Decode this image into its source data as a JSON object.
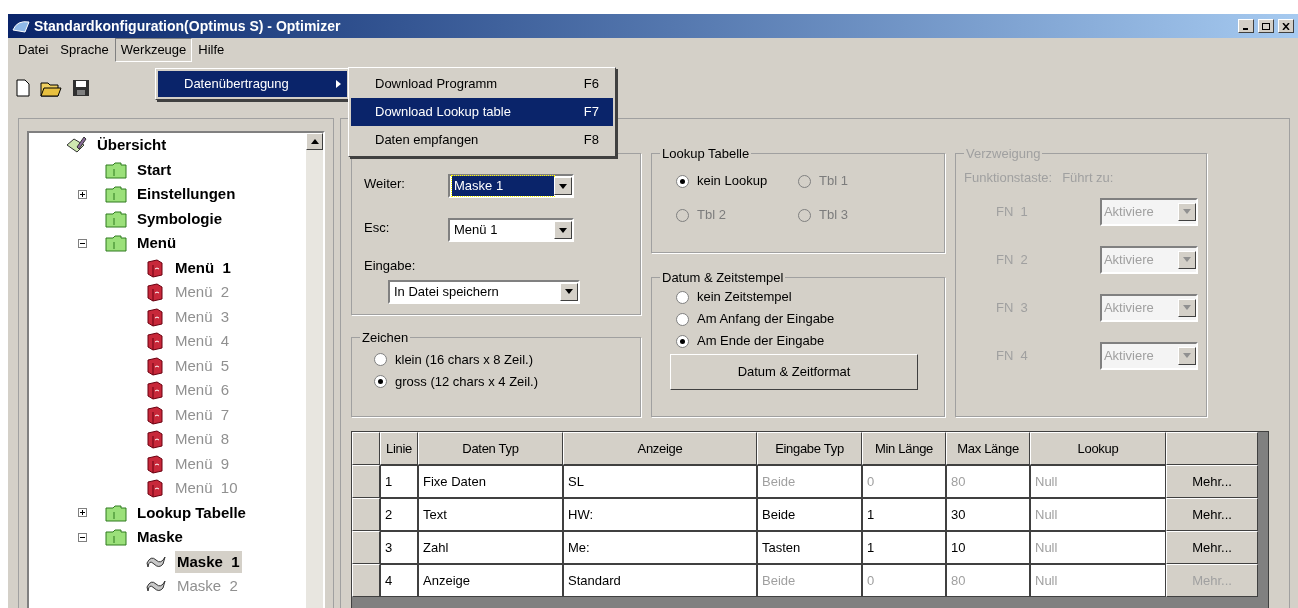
{
  "window": {
    "title": "Standardkonfiguration(Optimus S) - Optimizer"
  },
  "menu_bar": [
    {
      "label": "Datei",
      "selected": false
    },
    {
      "label": "Sprache",
      "selected": false
    },
    {
      "label": "Werkzeuge",
      "selected": true
    },
    {
      "label": "Hilfe",
      "selected": false
    }
  ],
  "menu_open": {
    "items": [
      {
        "label": "Datenübertragung",
        "selected": true
      }
    ],
    "submenu": [
      {
        "label": "Download Programm",
        "shortcut": "F6",
        "selected": false
      },
      {
        "label": "Download Lookup table",
        "shortcut": "F7",
        "selected": true
      },
      {
        "label": "Daten empfangen",
        "shortcut": "F8",
        "selected": false
      }
    ]
  },
  "tree": [
    {
      "label": "Übersicht",
      "kind": "root",
      "bold": true,
      "dim": false,
      "selected": false,
      "children": [
        {
          "label": "Start",
          "kind": "folder",
          "bold": true,
          "dim": false,
          "selected": false
        },
        {
          "label": "Einstellungen",
          "kind": "folder",
          "bold": true,
          "dim": false,
          "selected": false,
          "expanded": false
        },
        {
          "label": "Symbologie",
          "kind": "folder",
          "bold": true,
          "dim": false,
          "selected": false
        },
        {
          "label": "Menü",
          "kind": "folder",
          "bold": true,
          "dim": false,
          "selected": false,
          "expanded": true,
          "children": [
            {
              "label": "Menü  1",
              "kind": "book",
              "bold": true,
              "dim": false,
              "selected": false
            },
            {
              "label": "Menü  2",
              "kind": "book",
              "bold": false,
              "dim": true,
              "selected": false
            },
            {
              "label": "Menü  3",
              "kind": "book",
              "bold": false,
              "dim": true,
              "selected": false
            },
            {
              "label": "Menü  4",
              "kind": "book",
              "bold": false,
              "dim": true,
              "selected": false
            },
            {
              "label": "Menü  5",
              "kind": "book",
              "bold": false,
              "dim": true,
              "selected": false
            },
            {
              "label": "Menü  6",
              "kind": "book",
              "bold": false,
              "dim": true,
              "selected": false
            },
            {
              "label": "Menü  7",
              "kind": "book",
              "bold": false,
              "dim": true,
              "selected": false
            },
            {
              "label": "Menü  8",
              "kind": "book",
              "bold": false,
              "dim": true,
              "selected": false
            },
            {
              "label": "Menü  9",
              "kind": "book",
              "bold": false,
              "dim": true,
              "selected": false
            },
            {
              "label": "Menü  10",
              "kind": "book",
              "bold": false,
              "dim": true,
              "selected": false
            }
          ]
        },
        {
          "label": "Lookup Tabelle",
          "kind": "folder",
          "bold": true,
          "dim": false,
          "selected": false,
          "expanded": false
        },
        {
          "label": "Maske",
          "kind": "folder",
          "bold": true,
          "dim": false,
          "selected": false,
          "expanded": true,
          "children": [
            {
              "label": "Maske  1",
              "kind": "mask",
              "bold": true,
              "dim": false,
              "selected": true
            },
            {
              "label": "Maske  2",
              "kind": "mask",
              "bold": false,
              "dim": true,
              "selected": false
            }
          ]
        }
      ]
    }
  ],
  "ereignis": {
    "fields": [
      {
        "label": "Weiter:",
        "value": "Maske 1",
        "focused": true
      },
      {
        "label": "Esc:",
        "value": "Menü 1",
        "focused": false
      }
    ],
    "eingabe_label": "Eingabe:",
    "eingabe_value": "In Datei speichern"
  },
  "zeichen": {
    "title": "Zeichen",
    "options": [
      {
        "label": "klein (16 chars x 8 Zeil.)",
        "selected": false,
        "disabled": false
      },
      {
        "label": "gross (12 chars x 4 Zeil.)",
        "selected": true,
        "disabled": false
      }
    ]
  },
  "lookup_tabelle": {
    "title": "Lookup Tabelle",
    "options": [
      {
        "label": "kein Lookup",
        "selected": true,
        "disabled": false
      },
      {
        "label": "Tbl 1",
        "selected": false,
        "disabled": true
      },
      {
        "label": "Tbl 2",
        "selected": false,
        "disabled": true
      },
      {
        "label": "Tbl 3",
        "selected": false,
        "disabled": true
      }
    ]
  },
  "datum": {
    "title": "Datum & Zeitstempel",
    "options": [
      {
        "label": "kein Zeitstempel",
        "selected": false,
        "disabled": false
      },
      {
        "label": "Am Anfang der Eingabe",
        "selected": false,
        "disabled": false
      },
      {
        "label": "Am Ende der Eingabe",
        "selected": true,
        "disabled": false
      }
    ],
    "button": "Datum & Zeitformat"
  },
  "verzweigung": {
    "title": "Verzweigung",
    "disabled": true,
    "col_1": "Funktionstaste:",
    "col_2": "Führt zu:",
    "rows": [
      {
        "key": "FN  1",
        "value": "Aktiviere"
      },
      {
        "key": "FN  2",
        "value": "Aktiviere"
      },
      {
        "key": "FN  3",
        "value": "Aktiviere"
      },
      {
        "key": "FN  4",
        "value": "Aktiviere"
      }
    ]
  },
  "table": {
    "columns": [
      "Linie",
      "Daten Typ",
      "Anzeige",
      "Eingabe Typ",
      "Min Länge",
      "Max Länge",
      "Lookup"
    ],
    "rows": [
      {
        "cells": [
          {
            "text": "1",
            "dim": false
          },
          {
            "text": "Fixe Daten",
            "dim": false
          },
          {
            "text": "SL",
            "dim": false
          },
          {
            "text": "Beide",
            "dim": true
          },
          {
            "text": "0",
            "dim": true
          },
          {
            "text": "80",
            "dim": true
          },
          {
            "text": "Null",
            "dim": true
          }
        ],
        "button": "Mehr...",
        "button_disabled": false
      },
      {
        "cells": [
          {
            "text": "2",
            "dim": false
          },
          {
            "text": "Text",
            "dim": false
          },
          {
            "text": "HW:",
            "dim": false
          },
          {
            "text": "Beide",
            "dim": false
          },
          {
            "text": "1",
            "dim": false
          },
          {
            "text": "30",
            "dim": false
          },
          {
            "text": "Null",
            "dim": true
          }
        ],
        "button": "Mehr...",
        "button_disabled": false
      },
      {
        "cells": [
          {
            "text": "3",
            "dim": false
          },
          {
            "text": "Zahl",
            "dim": false
          },
          {
            "text": "Me:",
            "dim": false
          },
          {
            "text": "Tasten",
            "dim": false
          },
          {
            "text": "1",
            "dim": false
          },
          {
            "text": "10",
            "dim": false
          },
          {
            "text": "Null",
            "dim": true
          }
        ],
        "button": "Mehr...",
        "button_disabled": false
      },
      {
        "cells": [
          {
            "text": "4",
            "dim": false
          },
          {
            "text": "Anzeige",
            "dim": false
          },
          {
            "text": "Standard",
            "dim": false
          },
          {
            "text": "Beide",
            "dim": true
          },
          {
            "text": "0",
            "dim": true
          },
          {
            "text": "80",
            "dim": true
          },
          {
            "text": "Null",
            "dim": true
          }
        ],
        "button": "Mehr...",
        "button_disabled": true
      }
    ]
  }
}
